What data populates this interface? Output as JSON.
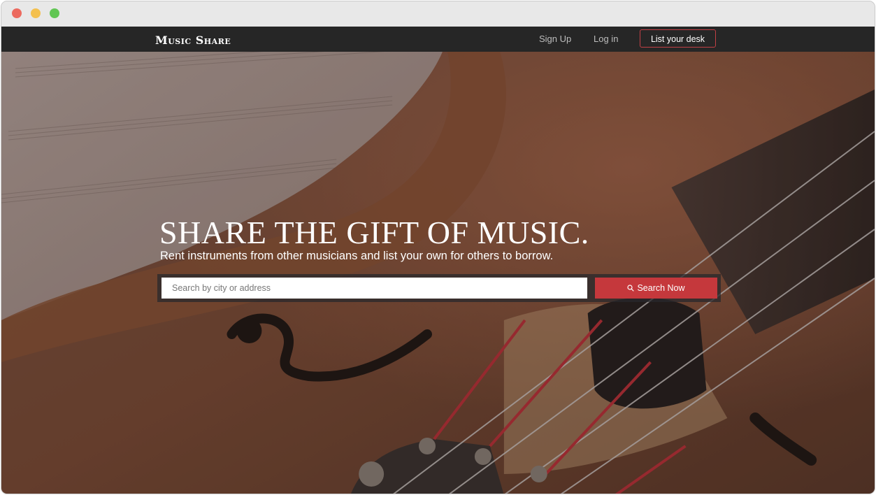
{
  "colors": {
    "accent": "#c5383c",
    "navbar": "#262626",
    "traffic_red": "#ec6a5f",
    "traffic_yellow": "#f4c04f",
    "traffic_green": "#61c654"
  },
  "nav": {
    "logo": "Music Share",
    "signup_label": "Sign Up",
    "login_label": "Log in",
    "cta_label": "List your desk"
  },
  "hero": {
    "title": "SHARE THE GIFT OF MUSIC.",
    "subtitle": "Rent instruments from other musicians and list your own for others to borrow.",
    "search": {
      "placeholder": "Search by city or address",
      "value": "",
      "button_label": "Search Now",
      "button_icon": "search-icon"
    }
  }
}
